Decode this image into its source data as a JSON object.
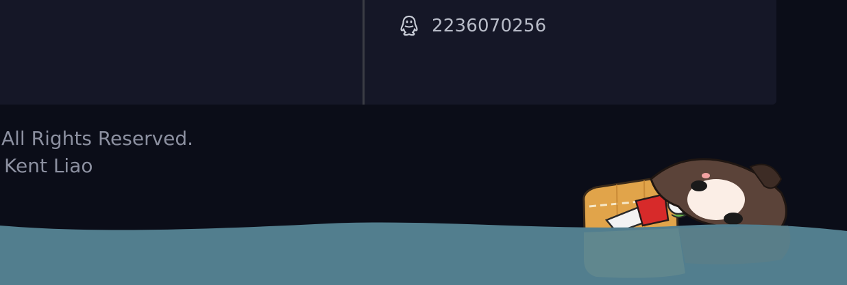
{
  "contact": {
    "qq_icon": "qq-penguin-icon",
    "qq_number": "2236070256"
  },
  "footer": {
    "copyright": "All Rights Reserved.",
    "author": "Kent Liao"
  },
  "decoration": {
    "water_color": "#527e8e",
    "mascot": "floating-girl-on-boat"
  },
  "colors": {
    "page_background": "#0b0d18",
    "card_background": "#151727",
    "divider": "#3b3d45",
    "text_primary": "#b8bcc8",
    "text_muted": "#8c90a0"
  }
}
